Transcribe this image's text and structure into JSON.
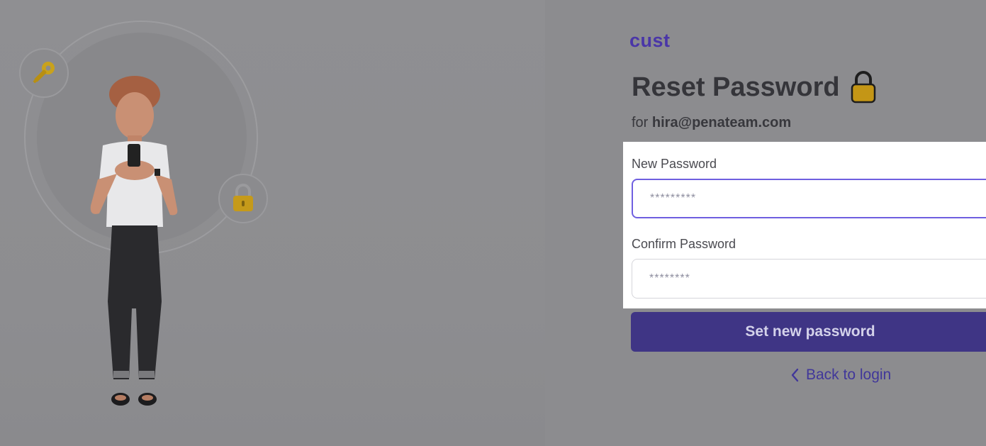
{
  "brand": {
    "logo_text": "cust",
    "accent_color": "#4a36a8"
  },
  "header": {
    "title": "Reset Password",
    "title_icon": "lock-icon",
    "subtitle_prefix": "for",
    "email": "hira@penateam.com"
  },
  "form": {
    "new_password": {
      "label": "New Password",
      "placeholder": "*********"
    },
    "confirm_password": {
      "label": "Confirm Password",
      "placeholder": "********"
    },
    "submit_label": "Set new password",
    "submit_color": "#3f3585"
  },
  "footer": {
    "back_label": "Back to login",
    "back_icon": "chevron-left-icon"
  },
  "illustration": {
    "badges": [
      "key-icon",
      "padlock-icon"
    ]
  }
}
